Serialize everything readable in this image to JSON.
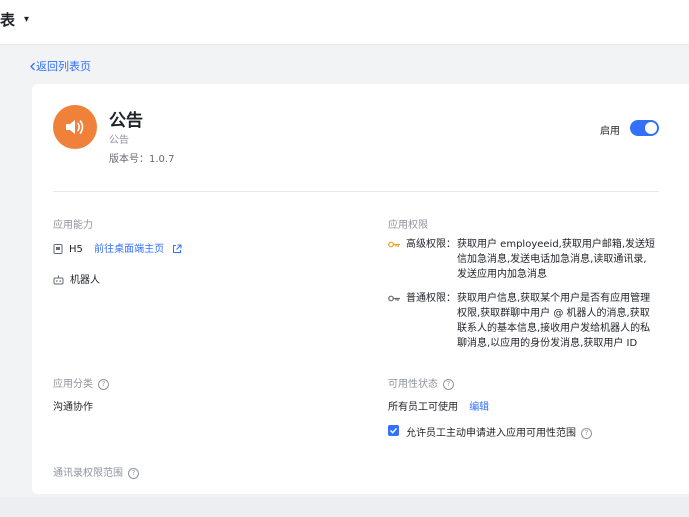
{
  "header": {
    "title": "表",
    "caret": "▾"
  },
  "back_link": "返回列表页",
  "app": {
    "name": "公告",
    "subtitle": "公告",
    "version": "版本号：1.0.7",
    "enable_label": "启用",
    "enabled": true,
    "icon": "speaker-icon",
    "icon_color": "#f0813b"
  },
  "capabilities": {
    "title": "应用能力",
    "h5_label": "H5",
    "h5_link": "前往桌面端主页",
    "bot_label": "机器人"
  },
  "permissions": {
    "title": "应用权限",
    "advanced_label": "高级权限：",
    "advanced_lines": [
      "获取用户 employeeid,获取用户邮箱,发送短",
      "信加急消息,发送电话加急消息,读取通讯录,",
      "发送应用内加急消息"
    ],
    "normal_label": "普通权限：",
    "normal_lines": [
      "获取用户信息,获取某个用户是否有应用管理",
      "权限,获取群聊中用户 @ 机器人的消息,获取",
      "联系人的基本信息,接收用户发给机器人的私",
      "聊消息,以应用的身份发消息,获取用户 ID"
    ]
  },
  "category": {
    "title": "应用分类",
    "value": "沟通协作"
  },
  "availability": {
    "title": "可用性状态",
    "value": "所有员工可使用",
    "edit": "编辑",
    "allow_apply": "允许员工主动申请进入应用可用性范围",
    "allow_apply_checked": true
  },
  "contacts_scope": {
    "title": "通讯录权限范围"
  },
  "colors": {
    "accent": "#3370ff",
    "muted": "#8f959e",
    "key_gold": "#e8a317"
  }
}
